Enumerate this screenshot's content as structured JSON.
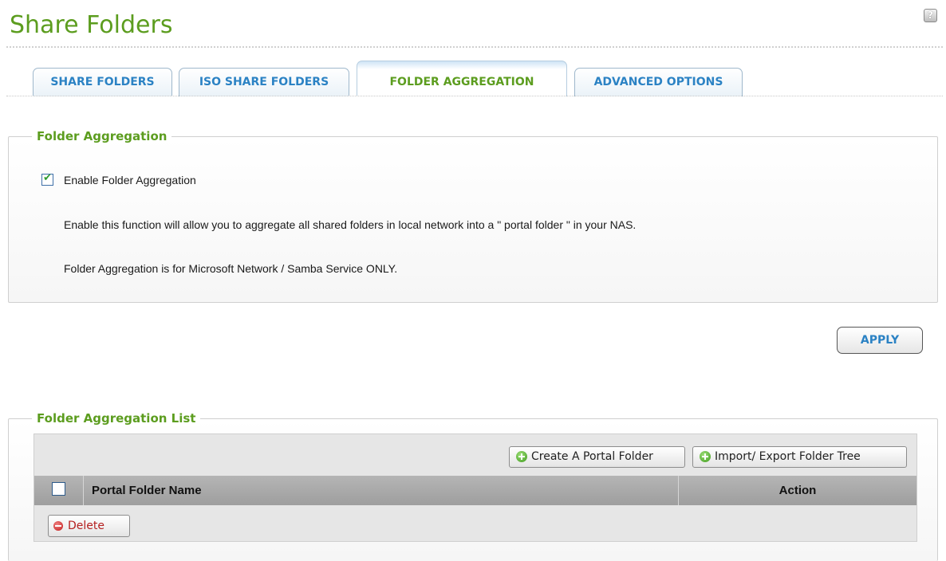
{
  "header": {
    "title": "Share Folders",
    "help_label": "?"
  },
  "tabs": [
    {
      "label": "SHARE FOLDERS"
    },
    {
      "label": "ISO SHARE FOLDERS"
    },
    {
      "label": "FOLDER AGGREGATION",
      "active": true
    },
    {
      "label": "ADVANCED OPTIONS"
    }
  ],
  "aggregation": {
    "legend": "Folder Aggregation",
    "enable_label": "Enable Folder Aggregation",
    "enabled": true,
    "description": "Enable this function will allow you to aggregate all shared folders in local network into a \" portal folder \" in your NAS.",
    "note": "Folder Aggregation is for Microsoft Network / Samba Service ONLY."
  },
  "apply_label": "APPLY",
  "list": {
    "legend": "Folder Aggregation List",
    "create_label": "Create A Portal Folder",
    "import_export_label": "Import/ Export Folder Tree",
    "columns": [
      "Portal Folder Name",
      "Action"
    ],
    "rows": [],
    "delete_label": "Delete"
  },
  "colors": {
    "accent_green": "#5c9d1f",
    "accent_blue": "#2b82c4",
    "delete_red": "#b52020"
  }
}
